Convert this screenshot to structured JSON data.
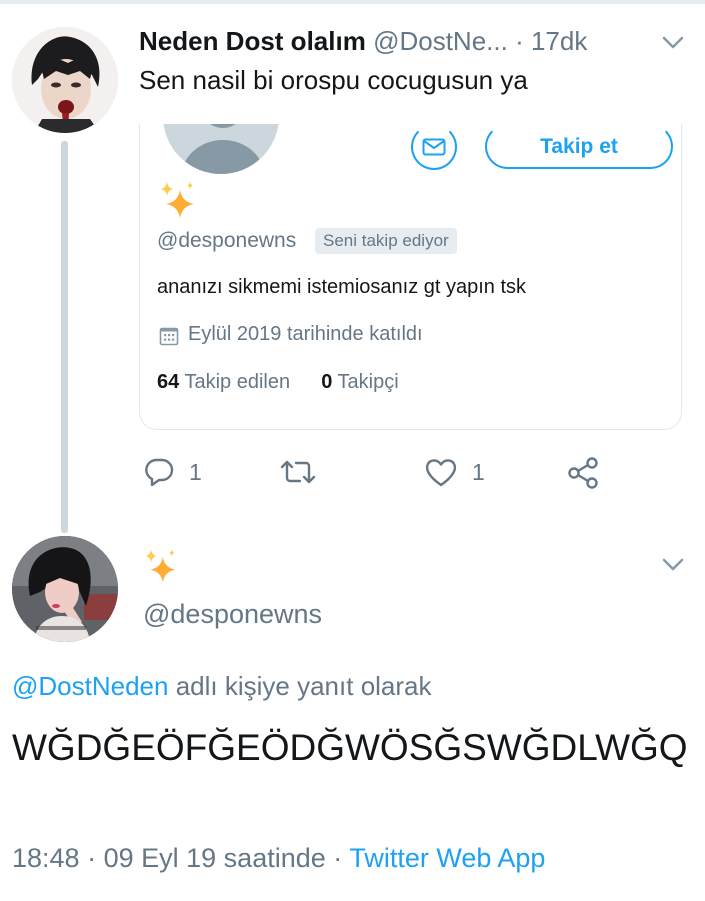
{
  "parent_tweet": {
    "author_name": "Neden Dost olalım",
    "author_handle": "@DostNe...",
    "separator": "·",
    "time": "17dk",
    "text": "Sen nasil bi orospu cocugusun ya",
    "card": {
      "follow_label": "Takip et",
      "handle": "@desponewns",
      "follows_you": "Seni takip ediyor",
      "bio": "ananızı sikmemi istemiosanız gt yapın tsk",
      "joined": "Eylül 2019 tarihinde katıldı",
      "following_count": "64",
      "following_label": "Takip edilen",
      "followers_count": "0",
      "followers_label": "Takipçi"
    },
    "actions": {
      "reply_count": "1",
      "retweet_count": "",
      "like_count": "1"
    }
  },
  "reply_tweet": {
    "display_name_emoji": "✨",
    "handle": "@desponewns",
    "replying_mention": "@DostNeden",
    "replying_suffix": "adlı kişiye yanıt olarak",
    "text": "WĞDĞEÖFĞEÖDĞWÖSĞSWĞDLWĞQ",
    "time": "18:48",
    "separator1": "·",
    "date": "09 Eyl 19 saatinde",
    "separator2": "·",
    "source": "Twitter Web App"
  },
  "icons": {
    "caret": "chevron-down-icon",
    "mail": "envelope-icon",
    "sparkle": "sparkles-icon",
    "calendar": "calendar-icon",
    "reply": "reply-bubble-icon",
    "retweet": "retweet-icon",
    "like": "heart-icon",
    "share": "share-icon"
  },
  "colors": {
    "accent": "#1da1f2",
    "secondary_text": "#657786",
    "primary_text": "#14171a",
    "divider": "#e1e8ed",
    "sparkle": "#ffac33"
  }
}
